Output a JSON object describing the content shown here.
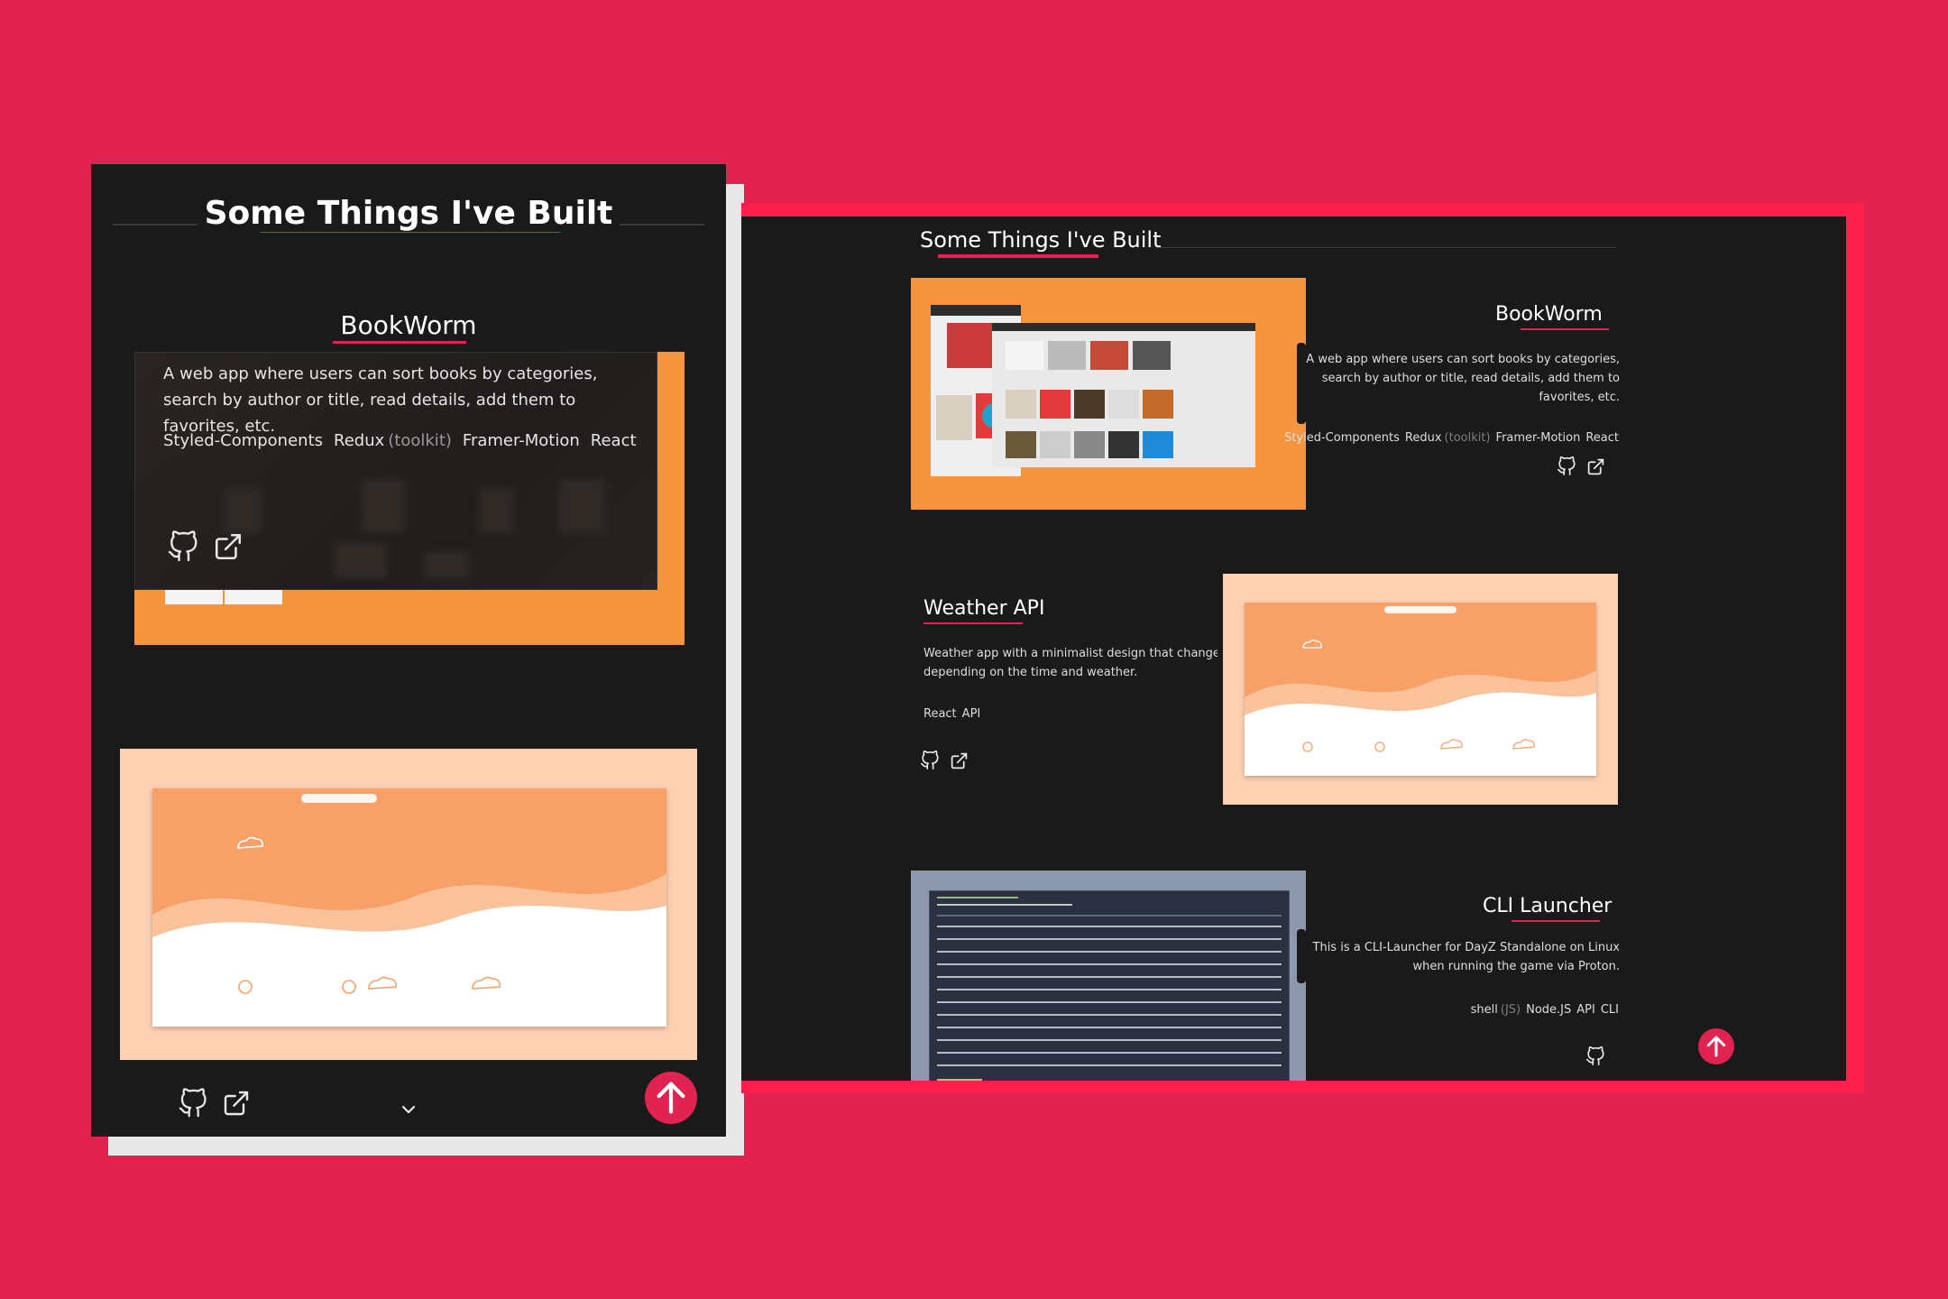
{
  "colors": {
    "accent": "#e02351",
    "panel": "#1a1a1a",
    "bookworm_bg": "#f7943f",
    "weather_bg": "#ffd1b3",
    "cli_bg": "#8e98ad"
  },
  "mobile": {
    "section_title": "Some Things I've Built",
    "project": {
      "title": "BookWorm",
      "description": "A web app where users can sort books by categories, search by author or title, read details, add them to favorites, etc.",
      "tags": [
        "Styled-Components",
        "Redux",
        "(toolkit)",
        "Framer-Motion",
        "React"
      ]
    },
    "icons": [
      "github-icon",
      "external-link-icon",
      "chevron-down-icon",
      "arrow-up-icon"
    ]
  },
  "desktop": {
    "section_title": "Some Things I've Built",
    "projects": [
      {
        "title": "BookWorm",
        "description": "A web app where users can sort books by categories, search by author or title, read details, add them to favorites, etc.",
        "tags": [
          "Styled-Components",
          "Redux",
          "(toolkit)",
          "Framer-Motion",
          "React"
        ]
      },
      {
        "title": "Weather API",
        "description": "Weather app with a minimalist design that changes depending on the time and weather.",
        "tags": [
          "React",
          "API"
        ]
      },
      {
        "title": "CLI Launcher",
        "description": "This is a CLI-Launcher for DayZ Standalone on Linux when running the game via Proton.",
        "tags": [
          "shell",
          "(JS)",
          "Node.JS",
          "API",
          "CLI"
        ]
      }
    ]
  }
}
